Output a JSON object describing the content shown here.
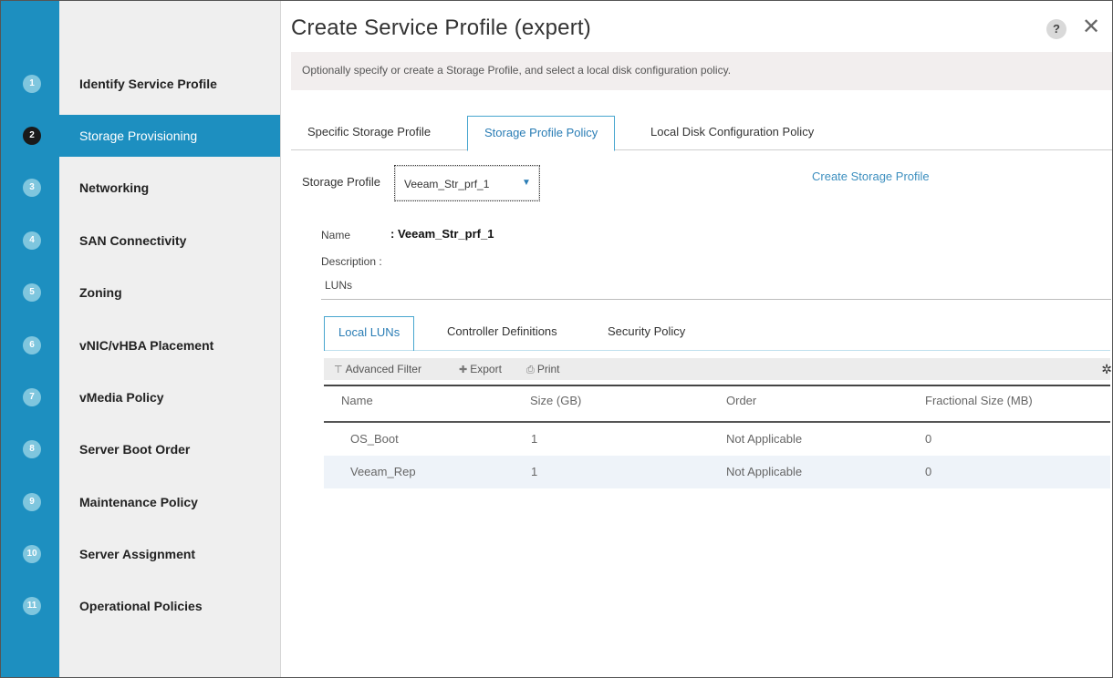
{
  "window": {
    "title": "Create Service Profile (expert)",
    "help_label": "?",
    "close_label": "✕"
  },
  "steps": [
    {
      "num": "1",
      "label": "Identify Service Profile"
    },
    {
      "num": "2",
      "label": "Storage Provisioning"
    },
    {
      "num": "3",
      "label": "Networking"
    },
    {
      "num": "4",
      "label": "SAN Connectivity"
    },
    {
      "num": "5",
      "label": "Zoning"
    },
    {
      "num": "6",
      "label": "vNIC/vHBA Placement"
    },
    {
      "num": "7",
      "label": "vMedia Policy"
    },
    {
      "num": "8",
      "label": "Server Boot Order"
    },
    {
      "num": "9",
      "label": "Maintenance Policy"
    },
    {
      "num": "10",
      "label": "Server Assignment"
    },
    {
      "num": "11",
      "label": "Operational Policies"
    }
  ],
  "active_step": "2",
  "info": {
    "text": "Optionally specify or create a Storage Profile, and select a local disk configuration policy."
  },
  "tabs": [
    {
      "label": "Specific Storage Profile"
    },
    {
      "label": "Storage Profile Policy"
    },
    {
      "label": "Local Disk Configuration Policy"
    }
  ],
  "active_tab": "Storage Profile Policy",
  "storage_profile": {
    "label": "Storage Profile",
    "value": "Veeam_Str_prf_1",
    "caret": "▼",
    "create_link": "Create Storage Profile"
  },
  "details": {
    "name_label": "Name",
    "name_value": ": Veeam_Str_prf_1",
    "description_label": "Description :",
    "luns_label": "LUNs"
  },
  "subtabs": [
    {
      "label": "Local LUNs"
    },
    {
      "label": "Controller Definitions"
    },
    {
      "label": "Security Policy"
    }
  ],
  "active_subtab": "Local LUNs",
  "toolbar": {
    "filter_icon": "⊤",
    "filter_label": "Advanced Filter",
    "export_icon": "✚",
    "export_label": "Export",
    "print_icon": "⎙",
    "print_label": "Print",
    "settings_icon": "✲"
  },
  "table": {
    "columns": [
      "Name",
      "Size (GB)",
      "Order",
      "Fractional Size (MB)"
    ],
    "rows": [
      [
        "OS_Boot",
        "1",
        "Not Applicable",
        "0"
      ],
      [
        "Veeam_Rep",
        "1",
        "Not Applicable",
        "0"
      ]
    ]
  },
  "colors": {
    "accent": "#1d8fc0",
    "link": "#3d8fbf",
    "step_inactive": "#7fc6de",
    "step_active": "#1a1a1a"
  }
}
